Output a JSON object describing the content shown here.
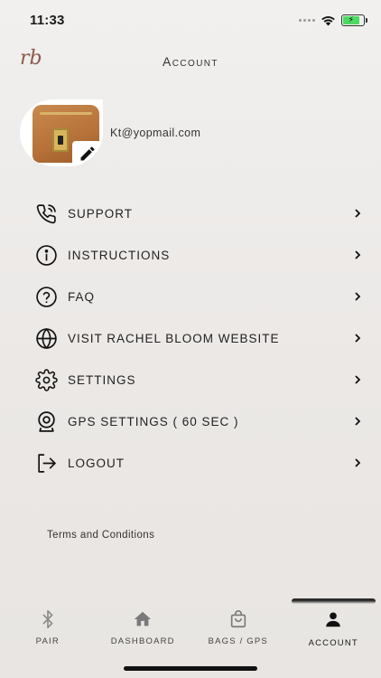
{
  "status_bar": {
    "time": "11:33"
  },
  "header": {
    "title": "Account",
    "logo_text": "rb"
  },
  "profile": {
    "email": "Kt@yopmail.com"
  },
  "menu": {
    "items": [
      {
        "label": "SUPPORT",
        "icon": "phone-call-icon"
      },
      {
        "label": "INSTRUCTIONS",
        "icon": "info-icon"
      },
      {
        "label": "FAQ",
        "icon": "question-icon"
      },
      {
        "label": "VISIT RACHEL BLOOM WEBSITE",
        "icon": "globe-icon"
      },
      {
        "label": "SETTINGS",
        "icon": "gear-icon"
      },
      {
        "label": "GPS SETTINGS ( 60 SEC )",
        "icon": "webcam-icon"
      },
      {
        "label": "LOGOUT",
        "icon": "logout-icon"
      }
    ]
  },
  "terms": {
    "label": "Terms and Conditions"
  },
  "tabbar": {
    "tabs": [
      {
        "label": "PAIR",
        "icon": "bluetooth-icon"
      },
      {
        "label": "DASHBOARD",
        "icon": "home-icon"
      },
      {
        "label": "BAGS / GPS",
        "icon": "shopping-bag-icon"
      },
      {
        "label": "ACCOUNT",
        "icon": "user-icon",
        "active": true
      }
    ]
  },
  "colors": {
    "battery": "#4cd964",
    "background": "#ebe8e6",
    "text": "#222222"
  }
}
